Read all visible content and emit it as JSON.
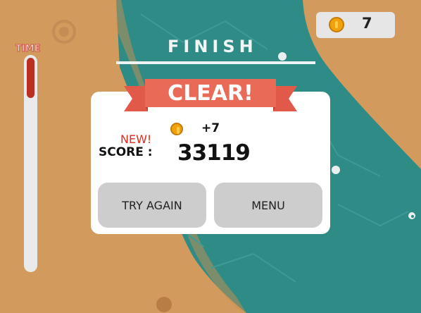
{
  "hud": {
    "time_label": "TIME",
    "time_remaining_fraction": 0.19,
    "coins": "7",
    "coin_icon": "coin-icon"
  },
  "course": {
    "finish_label": "FINISH"
  },
  "result_dialog": {
    "title": "CLEAR!",
    "new_badge": "NEW!",
    "coin_reward": "+7",
    "score_label": "SCORE :",
    "score_value": "33119",
    "buttons": {
      "try_again": "TRY AGAIN",
      "menu": "MENU"
    }
  },
  "colors": {
    "sand": "#d29a5c",
    "water": "#2e8b86",
    "ribbon": "#ea6a58",
    "time_fill": "#b92f24",
    "new_badge": "#e22a1f"
  }
}
